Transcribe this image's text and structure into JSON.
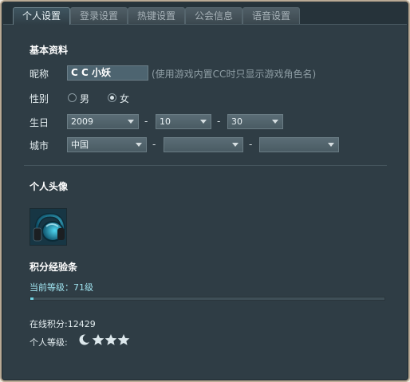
{
  "tabs": [
    {
      "label": "个人设置",
      "active": true
    },
    {
      "label": "登录设置",
      "active": false
    },
    {
      "label": "热键设置",
      "active": false
    },
    {
      "label": "公会信息",
      "active": false
    },
    {
      "label": "语音设置",
      "active": false
    }
  ],
  "basic": {
    "title": "基本资料",
    "nickname_label": "昵称",
    "nickname_value": "C C 小妖",
    "nickname_hint": "(使用游戏内置CC时只显示游戏角色名)",
    "gender_label": "性别",
    "gender_male": "男",
    "gender_female": "女",
    "gender_selected": "女",
    "birthday_label": "生日",
    "birth_year": "2009",
    "birth_month": "10",
    "birth_day": "30",
    "city_label": "城市",
    "country": "中国",
    "province": "",
    "city": "",
    "separator": "-"
  },
  "avatar": {
    "title": "个人头像",
    "icon": "headphones-avatar"
  },
  "exp": {
    "title": "积分经验条",
    "current_level": "当前等级：71级",
    "progress": 0.01,
    "points_text": "在线积分:12429",
    "level_label": "个人等级:",
    "badges": [
      "moon-icon",
      "star-icon",
      "star-icon",
      "star-icon"
    ]
  },
  "colors": {
    "panel_bg": "#2f3d45",
    "accent": "#6fd0e0",
    "active_tab_text": "#e8f2f5"
  }
}
